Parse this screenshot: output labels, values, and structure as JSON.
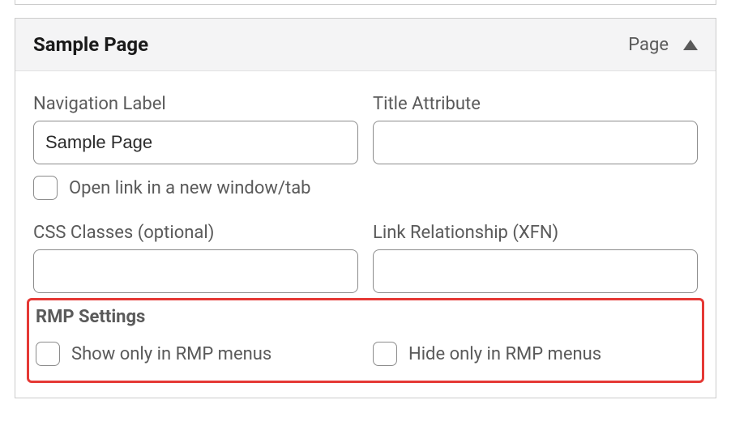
{
  "panel": {
    "title": "Sample Page",
    "type_label": "Page"
  },
  "fields": {
    "nav_label": {
      "label": "Navigation Label",
      "value": "Sample Page"
    },
    "title_attr": {
      "label": "Title Attribute",
      "value": ""
    },
    "open_new_tab": {
      "label": "Open link in a new window/tab"
    },
    "css_classes": {
      "label": "CSS Classes (optional)",
      "value": ""
    },
    "link_rel": {
      "label": "Link Relationship (XFN)",
      "value": ""
    }
  },
  "rmp": {
    "heading": "RMP Settings",
    "show_only": {
      "label": "Show only in RMP menus"
    },
    "hide_only": {
      "label": "Hide only in RMP menus"
    }
  }
}
